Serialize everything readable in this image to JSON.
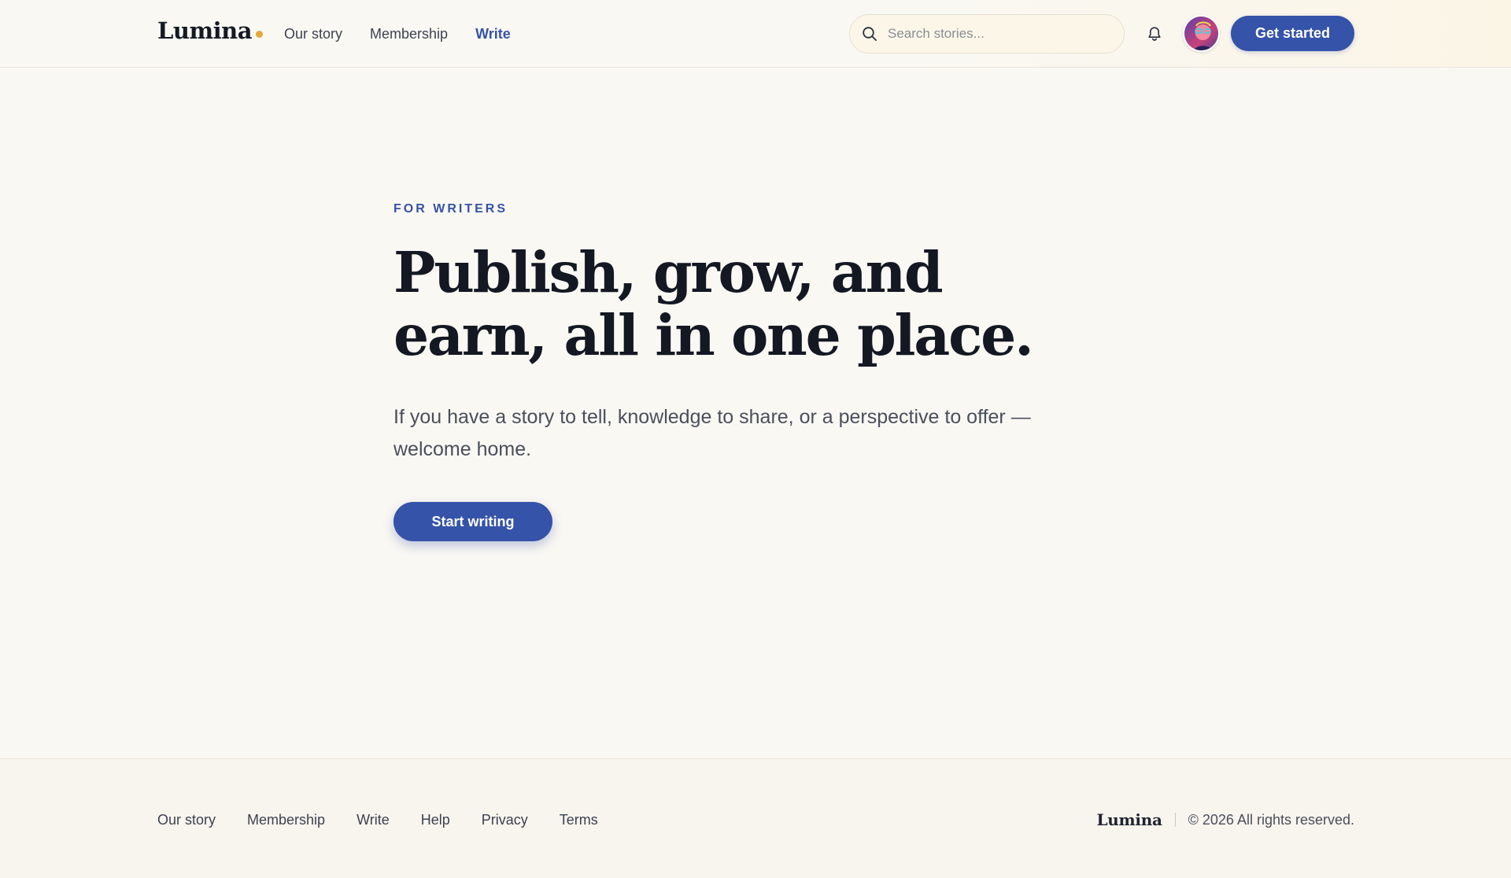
{
  "brand": {
    "name": "Lumina",
    "dot_color": "#e7a83a",
    "accent_color": "#3553a8"
  },
  "header": {
    "nav": [
      {
        "label": "Our story",
        "active": false
      },
      {
        "label": "Membership",
        "active": false
      },
      {
        "label": "Write",
        "active": true
      }
    ],
    "search": {
      "placeholder": "Search stories...",
      "value": "",
      "icon": "search-icon"
    },
    "notifications_icon": "bell-icon",
    "avatar_icon": "user-avatar",
    "cta_label": "Get started"
  },
  "hero": {
    "eyebrow": "FOR WRITERS",
    "headline": "Publish, grow, and earn, all in one place.",
    "subtitle": "If you have a story to tell, knowledge to share, or a perspective to offer — welcome home.",
    "cta_label": "Start writing"
  },
  "footer": {
    "links": [
      "Our story",
      "Membership",
      "Write",
      "Help",
      "Privacy",
      "Terms"
    ],
    "brand": "Lumina",
    "copyright": "© 2026 All rights reserved."
  }
}
